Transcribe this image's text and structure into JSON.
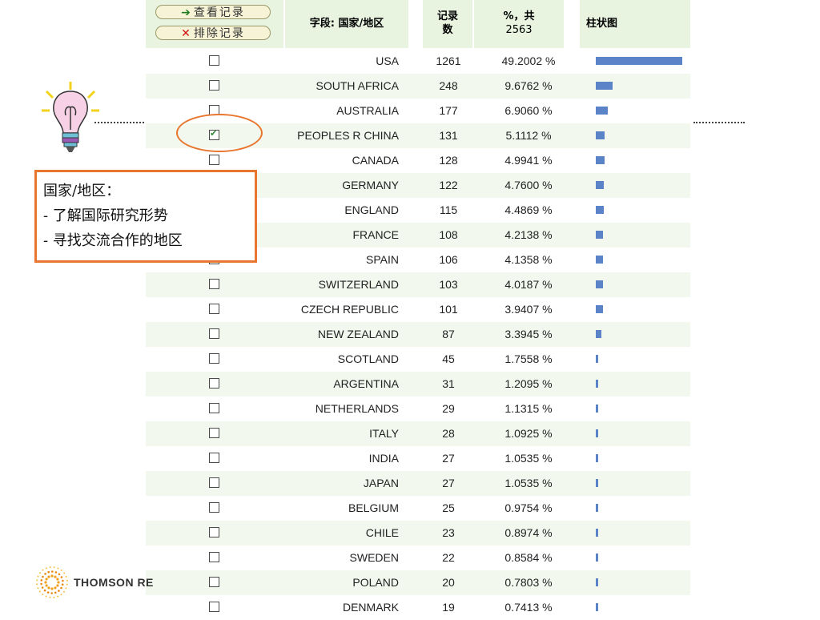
{
  "toolbar": {
    "view_records_label": "查看记录",
    "exclude_records_label": "排除记录"
  },
  "table": {
    "header": {
      "field": "字段: 国家/地区",
      "count_line1": "记录",
      "count_line2": "数",
      "pct_line1": "%，共",
      "pct_line2": "2563",
      "chart": "柱状图"
    },
    "rows": [
      {
        "country": "USA",
        "count": "1261",
        "pct": "49.2002 %",
        "checked": false,
        "share": 49.2002
      },
      {
        "country": "SOUTH AFRICA",
        "count": "248",
        "pct": "9.6762 %",
        "checked": false,
        "share": 9.6762
      },
      {
        "country": "AUSTRALIA",
        "count": "177",
        "pct": "6.9060 %",
        "checked": false,
        "share": 6.906
      },
      {
        "country": "PEOPLES R CHINA",
        "count": "131",
        "pct": "5.1112 %",
        "checked": true,
        "share": 5.1112
      },
      {
        "country": "CANADA",
        "count": "128",
        "pct": "4.9941 %",
        "checked": false,
        "share": 4.9941
      },
      {
        "country": "GERMANY",
        "count": "122",
        "pct": "4.7600 %",
        "checked": false,
        "share": 4.76
      },
      {
        "country": "ENGLAND",
        "count": "115",
        "pct": "4.4869 %",
        "checked": false,
        "share": 4.4869
      },
      {
        "country": "FRANCE",
        "count": "108",
        "pct": "4.2138 %",
        "checked": false,
        "share": 4.2138
      },
      {
        "country": "SPAIN",
        "count": "106",
        "pct": "4.1358 %",
        "checked": false,
        "share": 4.1358
      },
      {
        "country": "SWITZERLAND",
        "count": "103",
        "pct": "4.0187 %",
        "checked": false,
        "share": 4.0187
      },
      {
        "country": "CZECH REPUBLIC",
        "count": "101",
        "pct": "3.9407 %",
        "checked": false,
        "share": 3.9407
      },
      {
        "country": "NEW ZEALAND",
        "count": "87",
        "pct": "3.3945 %",
        "checked": false,
        "share": 3.3945
      },
      {
        "country": "SCOTLAND",
        "count": "45",
        "pct": "1.7558 %",
        "checked": false,
        "share": 1.7558
      },
      {
        "country": "ARGENTINA",
        "count": "31",
        "pct": "1.2095 %",
        "checked": false,
        "share": 1.2095
      },
      {
        "country": "NETHERLANDS",
        "count": "29",
        "pct": "1.1315 %",
        "checked": false,
        "share": 1.1315
      },
      {
        "country": "ITALY",
        "count": "28",
        "pct": "1.0925 %",
        "checked": false,
        "share": 1.0925
      },
      {
        "country": "INDIA",
        "count": "27",
        "pct": "1.0535 %",
        "checked": false,
        "share": 1.0535
      },
      {
        "country": "JAPAN",
        "count": "27",
        "pct": "1.0535 %",
        "checked": false,
        "share": 1.0535
      },
      {
        "country": "BELGIUM",
        "count": "25",
        "pct": "0.9754 %",
        "checked": false,
        "share": 0.9754
      },
      {
        "country": "CHILE",
        "count": "23",
        "pct": "0.8974 %",
        "checked": false,
        "share": 0.8974
      },
      {
        "country": "SWEDEN",
        "count": "22",
        "pct": "0.8584 %",
        "checked": false,
        "share": 0.8584
      },
      {
        "country": "POLAND",
        "count": "20",
        "pct": "0.7803 %",
        "checked": false,
        "share": 0.7803
      },
      {
        "country": "DENMARK",
        "count": "19",
        "pct": "0.7413 %",
        "checked": false,
        "share": 0.7413
      }
    ]
  },
  "annotation": {
    "title": "国家/地区：",
    "line1": "- 了解国际研究形势",
    "line2": "- 寻找交流合作的地区"
  },
  "footer": {
    "logo_text": "THOMSON RE"
  },
  "colors": {
    "accent": "#e8762e",
    "bar": "#5b84c8",
    "header_bg": "#e8f4e0"
  },
  "icons": [
    "lightbulb-icon",
    "arrow-right-icon",
    "x-mark-icon",
    "thomson-logo-icon"
  ]
}
